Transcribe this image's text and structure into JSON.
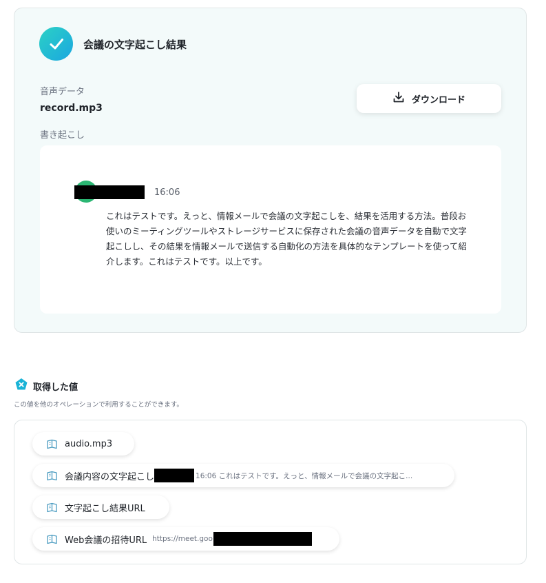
{
  "result": {
    "title": "会議の文字起こし結果",
    "audio_label": "音声データ",
    "audio_file": "record.mp3",
    "transcript_label": "書き起こし",
    "download_label": "ダウンロード",
    "entry": {
      "time": "16:06",
      "text": "これはテストです。えっと、情報メールで会議の文字起こしを、結果を活用する方法。普段お使いのミーティングツールやストレージサービスに保存された会議の音声データを自動で文字起こしし、その結果を情報メールで送信する自動化の方法を具体的なテンプレートを使って紹介します。これはテストです。以上です。"
    }
  },
  "values_section": {
    "title": "取得した値",
    "description": "この値を他のオペレーションで利用することができます。",
    "items": [
      {
        "label": "audio.mp3",
        "preview": ""
      },
      {
        "label": "会議内容の文字起こし",
        "preview": "16:06 これはテストです。えっと、情報メールで会議の文字起こ..."
      },
      {
        "label": "文字起こし結果URL",
        "preview": ""
      },
      {
        "label": "Web会議の招待URL",
        "preview": "https://meet.goo"
      }
    ]
  },
  "colors": {
    "accent_gradient_start": "#2cd1c5",
    "accent_gradient_end": "#1aa7e0",
    "card_bg": "#f3fafa",
    "speaker_avatar": "#2bb673"
  },
  "icons": {
    "result_status": "check-icon",
    "download": "download-icon",
    "section": "variable-icon",
    "chip": "book-icon"
  }
}
